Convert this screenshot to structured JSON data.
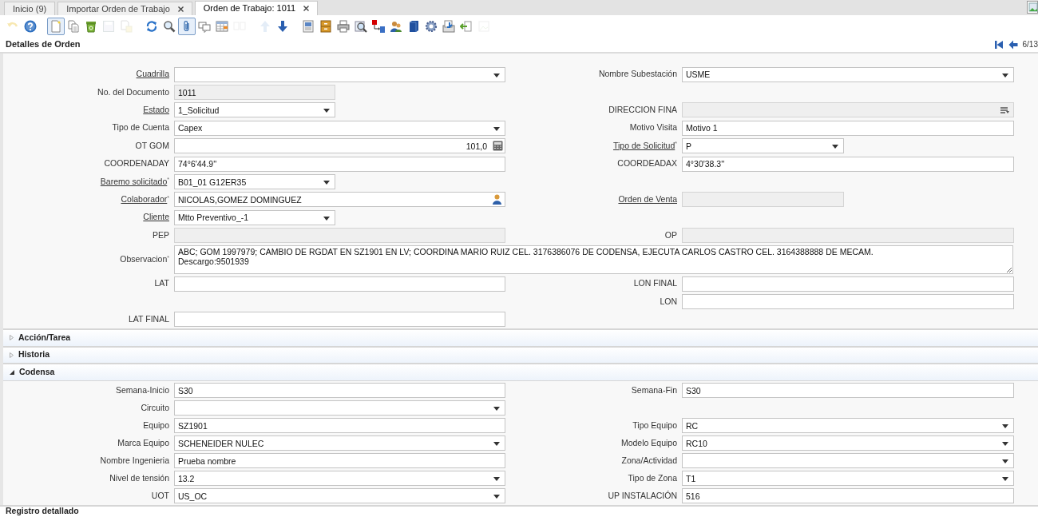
{
  "tabs": [
    {
      "label": "Inicio (9)",
      "selected": false,
      "closable": false
    },
    {
      "label": "Importar Orden de Trabajo",
      "selected": false,
      "closable": true
    },
    {
      "label": "Orden de Trabajo: 1011",
      "selected": true,
      "closable": true
    }
  ],
  "toolbar": [
    [
      {
        "kind": "undo",
        "disabled": true,
        "pressed": false
      },
      {
        "kind": "help",
        "disabled": false,
        "pressed": false
      }
    ],
    [
      {
        "kind": "new",
        "disabled": false,
        "pressed": true
      },
      {
        "kind": "copy",
        "disabled": false,
        "pressed": false
      },
      {
        "kind": "delete",
        "disabled": false,
        "pressed": false
      },
      {
        "kind": "save",
        "disabled": true,
        "pressed": false
      },
      {
        "kind": "ignore",
        "disabled": true,
        "pressed": false
      }
    ],
    [
      {
        "kind": "refresh",
        "disabled": false,
        "pressed": false
      },
      {
        "kind": "find",
        "disabled": false,
        "pressed": false
      },
      {
        "kind": "attach",
        "disabled": false,
        "pressed": true
      },
      {
        "kind": "chat",
        "disabled": false,
        "pressed": false
      },
      {
        "kind": "grid",
        "disabled": false,
        "pressed": false
      },
      {
        "kind": "detail",
        "disabled": true,
        "pressed": false
      }
    ],
    [
      {
        "kind": "up",
        "disabled": true,
        "pressed": false
      },
      {
        "kind": "down",
        "disabled": false,
        "pressed": false
      }
    ],
    [
      {
        "kind": "report",
        "disabled": false,
        "pressed": false
      },
      {
        "kind": "archive",
        "disabled": false,
        "pressed": false
      },
      {
        "kind": "print",
        "disabled": false,
        "pressed": false
      },
      {
        "kind": "zoom",
        "disabled": false,
        "pressed": false
      },
      {
        "kind": "workflow",
        "disabled": false,
        "pressed": false
      },
      {
        "kind": "people",
        "disabled": false,
        "pressed": false
      },
      {
        "kind": "block",
        "disabled": false,
        "pressed": false
      },
      {
        "kind": "gear",
        "disabled": false,
        "pressed": false
      },
      {
        "kind": "import",
        "disabled": false,
        "pressed": false
      },
      {
        "kind": "return",
        "disabled": false,
        "pressed": false
      },
      {
        "kind": "image",
        "disabled": true,
        "pressed": false
      }
    ]
  ],
  "header": {
    "title": "Detalles de Orden",
    "record": "6/13"
  },
  "form": {
    "rows": [
      {
        "left": {
          "label": "Cuadrilla",
          "link": true,
          "kind": "select"
        },
        "right": {
          "label": "Nombre Subestación",
          "link": false,
          "kind": "select",
          "value": "USME"
        }
      },
      {
        "left": {
          "label": "No. del Documento",
          "link": false,
          "kind": "readonly-short",
          "value": "1011"
        }
      },
      {
        "left": {
          "label": "Estado",
          "link": true,
          "kind": "select-short",
          "value": "1_Solicitud"
        },
        "right": {
          "label": "DIRECCION FINA",
          "link": false,
          "kind": "lookup"
        }
      },
      {
        "left": {
          "label": "Tipo de Cuenta",
          "link": false,
          "kind": "select",
          "value": "Capex"
        },
        "right": {
          "label": "Motivo Visita",
          "link": false,
          "kind": "text",
          "value": "Motivo 1"
        }
      },
      {
        "left": {
          "label": "OT GOM",
          "link": false,
          "kind": "number",
          "value": "101,0"
        },
        "right": {
          "label": "Tipo de Solicitud",
          "link": true,
          "mark": "*",
          "kind": "select-short",
          "value": "P"
        }
      },
      {
        "left": {
          "label": "COORDENADAY",
          "link": false,
          "kind": "text",
          "value": "74°6'44.9''"
        },
        "right": {
          "label": "COORDEADAX",
          "link": false,
          "kind": "text",
          "value": "4°30'38.3''"
        }
      },
      {
        "left": {
          "label": "Baremo solicitado",
          "link": true,
          "mark": "*",
          "kind": "select-short",
          "value": "B01_01 G12ER35"
        }
      },
      {
        "left": {
          "label": "Colaborador",
          "link": true,
          "mark": "*",
          "kind": "person",
          "value": "NICOLAS,GOMEZ DOMINGUEZ"
        },
        "right": {
          "label": "Orden de Venta",
          "link": true,
          "kind": "readonly-short"
        }
      },
      {
        "left": {
          "label": "Cliente",
          "link": true,
          "kind": "select-short",
          "value": "Mtto Preventivo_-1"
        }
      },
      {
        "left": {
          "label": "PEP",
          "link": false,
          "kind": "readonly"
        },
        "right": {
          "label": "OP",
          "link": false,
          "kind": "readonly"
        }
      },
      {
        "wide": {
          "label": "Observacion",
          "link": false,
          "mark": "*",
          "kind": "textarea",
          "value": "ABC; GOM 1997979; CAMBIO DE RGDAT EN SZ1901 EN LV; COORDINA MARIO RUIZ CEL. 3176386076 DE CODENSA, EJECUTA CARLOS CASTRO CEL. 3164388888 DE MECAM.\nDescargo:9501939"
        }
      },
      {
        "left": {
          "label": "LAT",
          "link": false,
          "kind": "text"
        },
        "right": {
          "label": "LON FINAL",
          "link": false,
          "kind": "text"
        }
      },
      {
        "right": {
          "label": "LON",
          "link": false,
          "kind": "text"
        }
      },
      {
        "left": {
          "label": "LAT FINAL",
          "link": false,
          "kind": "text"
        }
      }
    ]
  },
  "sections": [
    {
      "title": "Acción/Tarea",
      "expanded": false
    },
    {
      "title": "Historia",
      "expanded": false
    },
    {
      "title": "Codensa",
      "expanded": true,
      "rows": [
        {
          "left": {
            "label": "Semana-Inicio",
            "link": false,
            "kind": "text",
            "value": "S30"
          },
          "right": {
            "label": "Semana-Fin",
            "link": false,
            "kind": "text",
            "value": "S30"
          }
        },
        {
          "left": {
            "label": "Circuito",
            "link": false,
            "kind": "select"
          }
        },
        {
          "left": {
            "label": "Equipo",
            "link": false,
            "kind": "text",
            "value": "SZ1901"
          },
          "right": {
            "label": "Tipo Equipo",
            "link": false,
            "kind": "select",
            "value": "RC"
          }
        },
        {
          "left": {
            "label": "Marca Equipo",
            "link": false,
            "kind": "select",
            "value": "SCHENEIDER NULEC"
          },
          "right": {
            "label": "Modelo Equipo",
            "link": false,
            "kind": "select",
            "value": "RC10"
          }
        },
        {
          "left": {
            "label": "Nombre Ingenieria",
            "link": false,
            "kind": "text",
            "value": "Prueba nombre"
          },
          "right": {
            "label": "Zona/Actividad",
            "link": false,
            "kind": "select"
          }
        },
        {
          "left": {
            "label": "Nivel de tensión",
            "link": false,
            "kind": "select",
            "value": "13.2"
          },
          "right": {
            "label": "Tipo de Zona",
            "link": false,
            "kind": "select",
            "value": "T1"
          }
        },
        {
          "left": {
            "label": "UOT",
            "link": false,
            "kind": "select",
            "value": "US_OC"
          },
          "right": {
            "label": "UP INSTALACIÓN",
            "link": false,
            "kind": "text",
            "value": "516"
          }
        }
      ]
    }
  ],
  "footer": {
    "title": "Registro detallado"
  }
}
